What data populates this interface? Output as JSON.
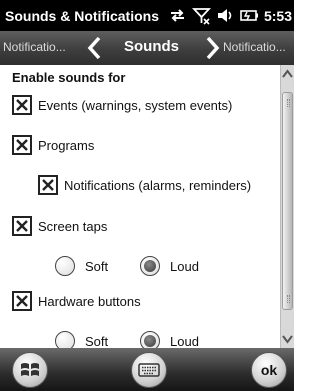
{
  "window": {
    "title": "Sounds & Notifications",
    "time": "5:53"
  },
  "tabs": {
    "previous": "Notificatio...",
    "current": "Sounds",
    "next": "Notificatio..."
  },
  "content": {
    "heading": "Enable sounds for",
    "events": {
      "label": "Events (warnings, system events)",
      "checked": true
    },
    "programs": {
      "label": "Programs",
      "checked": true
    },
    "notifications": {
      "label": "Notifications (alarms, reminders)",
      "checked": true
    },
    "screen_taps": {
      "label": "Screen taps",
      "checked": true,
      "options": [
        "Soft",
        "Loud"
      ],
      "selected": "Loud"
    },
    "hardware_buttons": {
      "label": "Hardware buttons",
      "checked": true,
      "options": [
        "Soft",
        "Loud"
      ],
      "selected": "Loud"
    }
  },
  "softkeys": {
    "ok_label": "ok"
  }
}
